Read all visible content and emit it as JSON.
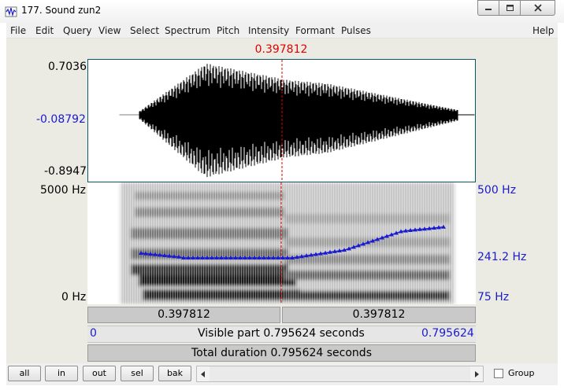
{
  "window": {
    "title": "177. Sound zun2"
  },
  "menu": [
    "File",
    "Edit",
    "Query",
    "View",
    "Select",
    "Spectrum",
    "Pitch",
    "Intensity",
    "Formant",
    "Pulses"
  ],
  "help": "Help",
  "cursor": {
    "time": "0.397812"
  },
  "waveform": {
    "max": "0.7036",
    "cursor_value": "-0.08792",
    "min": "-0.8947"
  },
  "spectrogram": {
    "top": "5000 Hz",
    "bottom": "0 Hz"
  },
  "pitch": {
    "top": "500 Hz",
    "cursor_value": "241.2 Hz",
    "bottom": "75 Hz"
  },
  "segments": {
    "left": "0.397812",
    "right": "0.397812"
  },
  "visible": {
    "start": "0",
    "text": "Visible part 0.795624 seconds",
    "end": "0.795624"
  },
  "total": {
    "text": "Total duration 0.795624 seconds"
  },
  "buttons": {
    "all": "all",
    "in": "in",
    "out": "out",
    "sel": "sel",
    "bak": "bak"
  },
  "group_label": "Group",
  "icons": [
    "app-icon",
    "minimize-icon",
    "maximize-icon",
    "close-icon",
    "scroll-left-icon",
    "scroll-right-icon"
  ],
  "colors": {
    "cursor": "#e00000",
    "pitch": "#1a1ad0",
    "frame": "#0b5766"
  }
}
